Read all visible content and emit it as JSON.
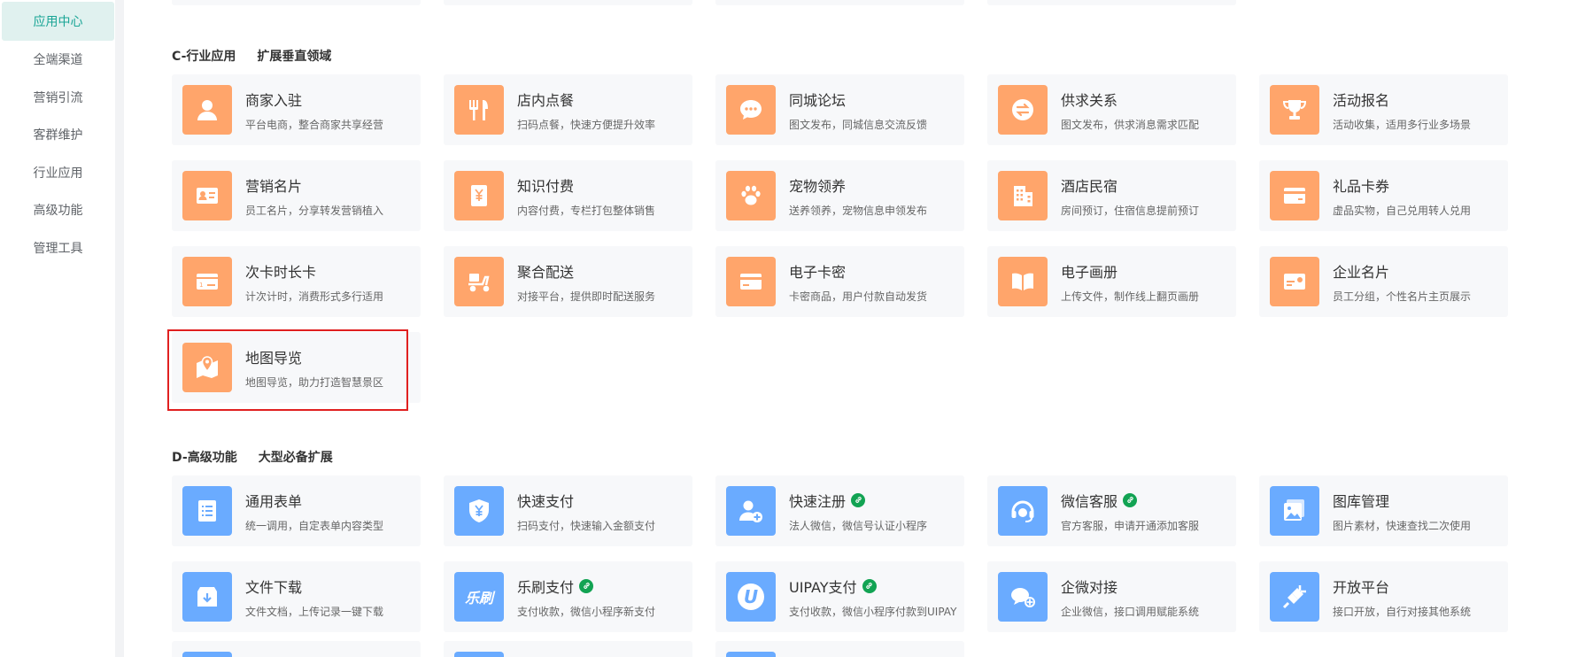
{
  "sidebar": {
    "items": [
      {
        "label": "应用中心",
        "active": true
      },
      {
        "label": "全端渠道"
      },
      {
        "label": "营销引流"
      },
      {
        "label": "客群维护"
      },
      {
        "label": "行业应用"
      },
      {
        "label": "高级功能"
      },
      {
        "label": "管理工具"
      }
    ]
  },
  "sections": [
    {
      "title": "C-行业应用",
      "subtitle": "扩展垂直领域",
      "cards": [
        {
          "name": "商家入驻",
          "desc": "平台电商，整合商家共享经营",
          "icon": "merchant-icon",
          "color": "orange"
        },
        {
          "name": "店内点餐",
          "desc": "扫码点餐，快速方便提升效率",
          "icon": "fork-knife-icon",
          "color": "orange"
        },
        {
          "name": "同城论坛",
          "desc": "图文发布，同城信息交流反馈",
          "icon": "chat-bubble-icon",
          "color": "orange"
        },
        {
          "name": "供求关系",
          "desc": "图文发布，供求消息需求匹配",
          "icon": "exchange-icon",
          "color": "orange"
        },
        {
          "name": "活动报名",
          "desc": "活动收集，适用多行业多场景",
          "icon": "trophy-icon",
          "color": "orange"
        },
        {
          "name": "营销名片",
          "desc": "员工名片，分享转发营销植入",
          "icon": "id-card-icon",
          "color": "orange"
        },
        {
          "name": "知识付费",
          "desc": "内容付费，专栏打包整体销售",
          "icon": "book-yen-icon",
          "color": "orange"
        },
        {
          "name": "宠物领养",
          "desc": "送养领养，宠物信息申领发布",
          "icon": "paw-icon",
          "color": "orange"
        },
        {
          "name": "酒店民宿",
          "desc": "房间预订，住宿信息提前预订",
          "icon": "hotel-icon",
          "color": "orange"
        },
        {
          "name": "礼品卡券",
          "desc": "虚品实物，自己兑用转人兑用",
          "icon": "gift-card-icon",
          "color": "orange"
        },
        {
          "name": "次卡时长卡",
          "desc": "计次计时，消费形式多行适用",
          "icon": "time-card-icon",
          "color": "orange"
        },
        {
          "name": "聚合配送",
          "desc": "对接平台，提供即时配送服务",
          "icon": "scooter-icon",
          "color": "orange"
        },
        {
          "name": "电子卡密",
          "desc": "卡密商品，用户付款自动发货",
          "icon": "card-icon",
          "color": "orange"
        },
        {
          "name": "电子画册",
          "desc": "上传文件，制作线上翻页画册",
          "icon": "open-book-icon",
          "color": "orange"
        },
        {
          "name": "企业名片",
          "desc": "员工分组，个性名片主页展示",
          "icon": "business-card-icon",
          "color": "orange"
        },
        {
          "name": "地图导览",
          "desc": "地图导览，助力打造智慧景区",
          "icon": "map-pin-icon",
          "color": "orange"
        }
      ]
    },
    {
      "title": "D-高级功能",
      "subtitle": "大型必备扩展",
      "cards": [
        {
          "name": "通用表单",
          "desc": "统一调用，自定表单内容类型",
          "icon": "form-icon",
          "color": "blue"
        },
        {
          "name": "快速支付",
          "desc": "扫码支付，快速输入金额支付",
          "icon": "yen-shield-icon",
          "color": "blue"
        },
        {
          "name": "快速注册",
          "desc": "法人微信，微信号认证小程序",
          "icon": "user-add-icon",
          "color": "blue",
          "link": true
        },
        {
          "name": "微信客服",
          "desc": "官方客服，申请开通添加客服",
          "icon": "headset-icon",
          "color": "blue",
          "link": true
        },
        {
          "name": "图库管理",
          "desc": "图片素材，快速查找二次使用",
          "icon": "gallery-icon",
          "color": "blue"
        },
        {
          "name": "文件下载",
          "desc": "文件文档，上传记录一键下载",
          "icon": "download-box-icon",
          "color": "blue"
        },
        {
          "name": "乐刷支付",
          "desc": "支付收款，微信小程序新支付",
          "icon": "leshua-logo-icon",
          "icon_text": "乐刷",
          "color": "blue",
          "link": true
        },
        {
          "name": "UIPAY支付",
          "desc": "支付收款，微信小程序付款到UIPAY",
          "icon": "uipay-logo-icon",
          "icon_text": "U",
          "color": "blue",
          "link": true
        },
        {
          "name": "企微对接",
          "desc": "企业微信，接口调用赋能系统",
          "icon": "wecom-icon",
          "color": "blue"
        },
        {
          "name": "开放平台",
          "desc": "接口开放，自行对接其他系统",
          "icon": "plug-icon",
          "color": "blue"
        }
      ]
    }
  ]
}
